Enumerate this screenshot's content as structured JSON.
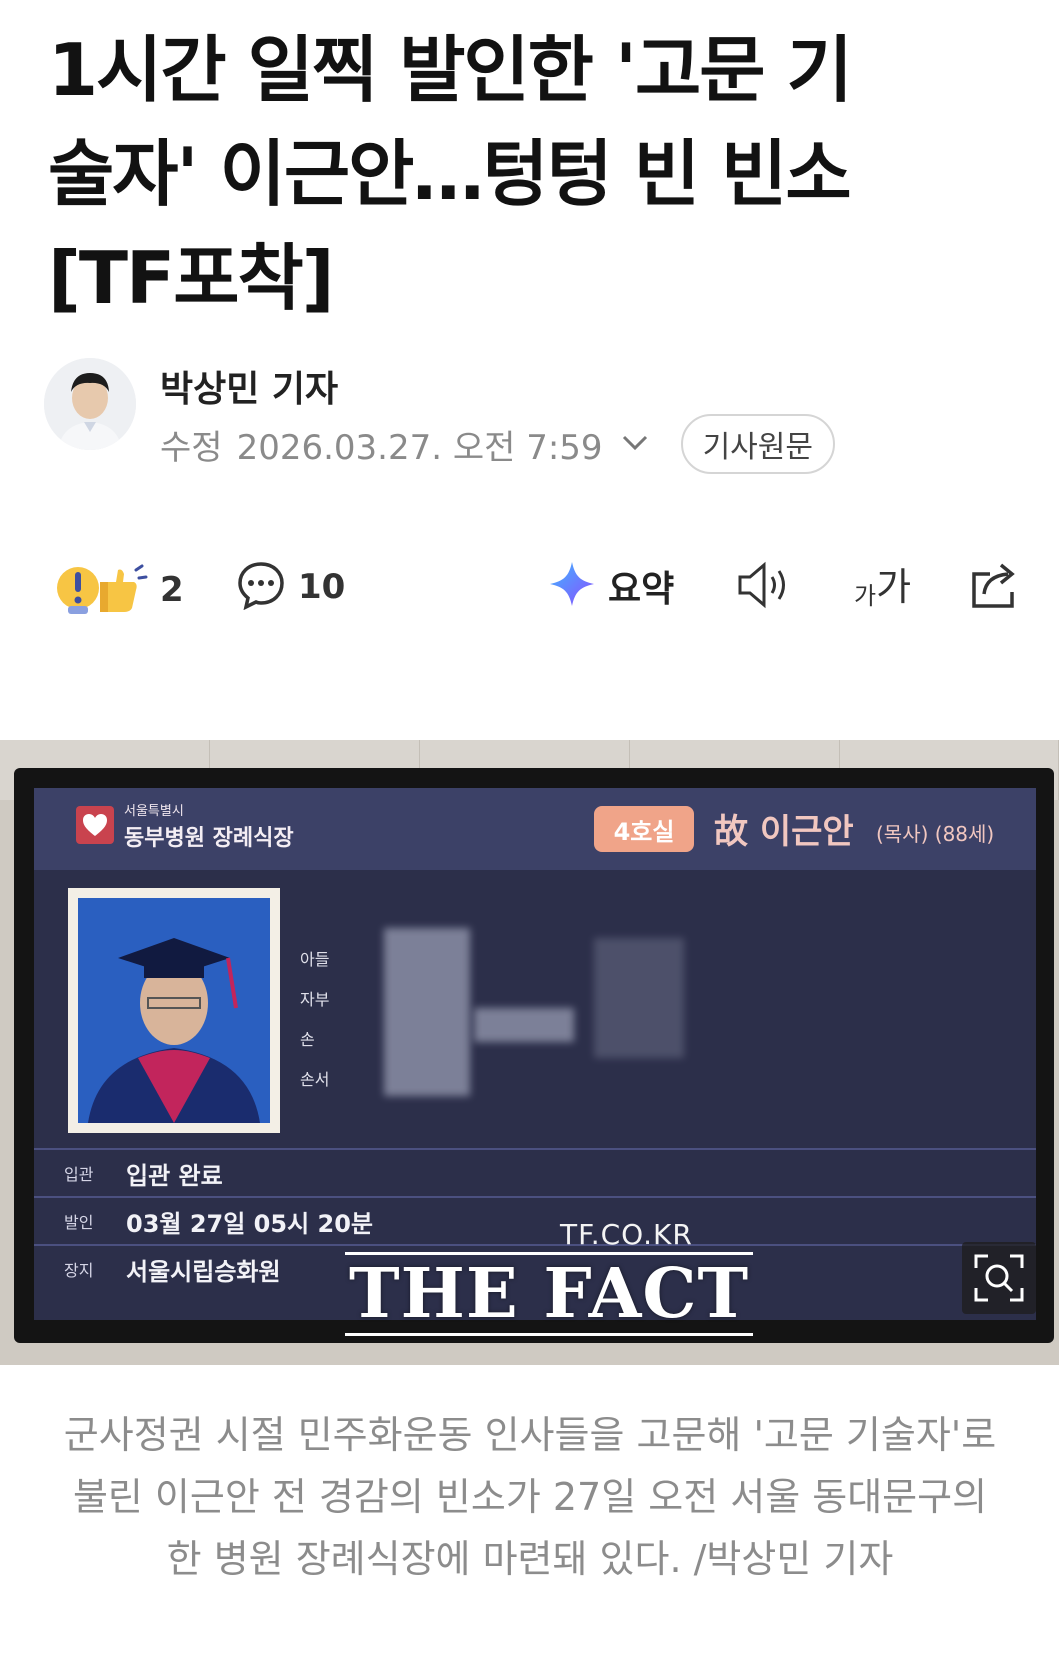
{
  "article": {
    "title": "1시간 일찍 발인한 '고문 기술자' 이근안…텅텅 빈 빈소 [TF포착]",
    "title_lines": [
      "1시간 일찍 발인한 '고문 기",
      "술자' 이근안…텅텅 빈 빈소",
      "[TF포착]"
    ]
  },
  "byline": {
    "reporter": "박상민 기자",
    "date_label": "수정",
    "date": "2026.03.27. 오전 7:59",
    "original_button": "기사원문"
  },
  "toolbar": {
    "reaction_count": "2",
    "comment_count": "10",
    "summary_label": "요약",
    "font_small": "가",
    "font_large": "가",
    "icons": [
      "reaction-icon",
      "comment-icon",
      "ai-summary-icon",
      "speaker-icon",
      "font-size-icon",
      "share-icon"
    ]
  },
  "photo": {
    "screen": {
      "hospital_small": "서울특별시",
      "hospital_name": "동부병원 장례식장",
      "room": "4호실",
      "deceased": "故 이근안",
      "deceased_detail": "(목사) (88세)",
      "relations": [
        "아들",
        "자부",
        "손",
        "손서"
      ],
      "rows": [
        {
          "key": "입관",
          "value": "입관 완료"
        },
        {
          "key": "발인",
          "value": "03월 27일 05시 20분"
        },
        {
          "key": "장지",
          "value": "서울시립승화원"
        }
      ]
    },
    "watermark_small": "TF.CO.KR",
    "watermark_big": "THE FACT"
  },
  "caption": "군사정권 시절 민주화운동 인사들을 고문해 '고문 기술자'로 불린 이근안 전 경감의 빈소가 27일 오전 서울 동대문구의 한 병원 장례식장에 마련돼 있다. /박상민 기자",
  "colors": {
    "headline": "#121212",
    "muted": "#8a8a8a",
    "screen_bg": "#2c2f4a",
    "room_badge": "#f0a489"
  }
}
